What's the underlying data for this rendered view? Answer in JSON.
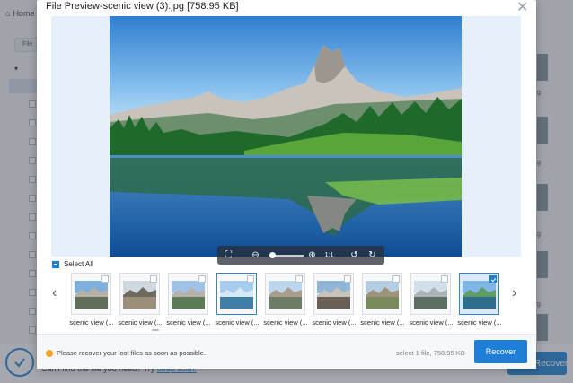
{
  "background": {
    "home_label": "Home",
    "file_button_label": "File",
    "cant_find_text": "Can't find the file you need? Try",
    "deep_scan_link": "deep scan.",
    "recover_label": "Recover",
    "thumb_label_suffix": "g"
  },
  "modal": {
    "title": "File Preview-scenic view (3).jpg [758.95 KB]",
    "close_label": "✕"
  },
  "zoombar": {
    "fit_icon": "fit-screen-icon",
    "zoom_out_icon": "zoom-out-icon",
    "zoom_in_icon": "zoom-in-icon",
    "actual_size_label": "1:1",
    "rotate_left_icon": "rotate-left-icon",
    "rotate_right_icon": "rotate-right-icon",
    "zoom_level": 0.1
  },
  "select_all_label": "Select All",
  "thumbnails": [
    {
      "label": "scenic view (...",
      "checked": false,
      "active": false
    },
    {
      "label": "scenic view (...",
      "checked": false,
      "active": false
    },
    {
      "label": "scenic view (...",
      "checked": false,
      "active": false
    },
    {
      "label": "scenic view (...",
      "checked": false,
      "active": true
    },
    {
      "label": "scenic view (...",
      "checked": false,
      "active": false
    },
    {
      "label": "scenic view (...",
      "checked": false,
      "active": false
    },
    {
      "label": "scenic view (...",
      "checked": false,
      "active": false
    },
    {
      "label": "scenic view (...",
      "checked": false,
      "active": false
    },
    {
      "label": "scenic view (...",
      "checked": true,
      "active": false
    }
  ],
  "footer": {
    "warning": "Please recover your lost files as soon as possible.",
    "selection_info": "select 1 file, 758.95 KB",
    "recover_button": "Recover"
  },
  "colors": {
    "accent": "#1f7ed8",
    "warning": "#f0a52a"
  }
}
